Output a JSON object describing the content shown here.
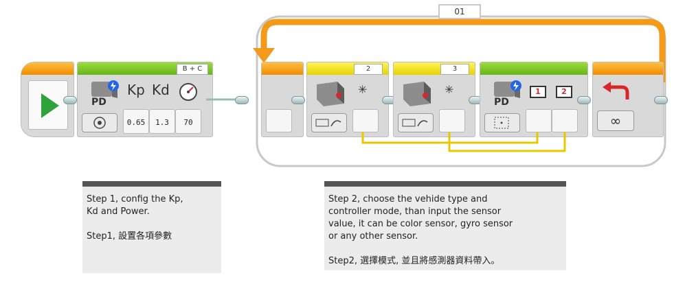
{
  "loop": {
    "name": "01",
    "mode_symbol": "∞"
  },
  "pid_block": {
    "port_label": "B + C",
    "label": "PD",
    "kp_label": "Kp",
    "kd_label": "Kd",
    "params": [
      "0.65",
      "1.3",
      "70"
    ]
  },
  "sensor_block_1": {
    "port": "2",
    "mode_symbol": "✳"
  },
  "sensor_block_2": {
    "port": "3",
    "mode_symbol": "✳"
  },
  "pd_block_2": {
    "label": "PD",
    "input_1": "1",
    "input_2": "2"
  },
  "notes": {
    "left": "Step 1, config the Kp,\nKd and Power.\n\nStep1, 設置各項參數",
    "right": "Step 2, choose the vehide type and\ncontroller mode, than input the sensor\nvalue, it can be color sensor, gyro sensor\nor any other sensor.\n\nStep2, 選擇模式, 並且將感測器資料帶入。"
  },
  "colors": {
    "loop_orange": "#f39a1a",
    "wire_yellow": "#e8c800",
    "start_green": "#2fa33a",
    "switch_red": "#d9262b"
  }
}
